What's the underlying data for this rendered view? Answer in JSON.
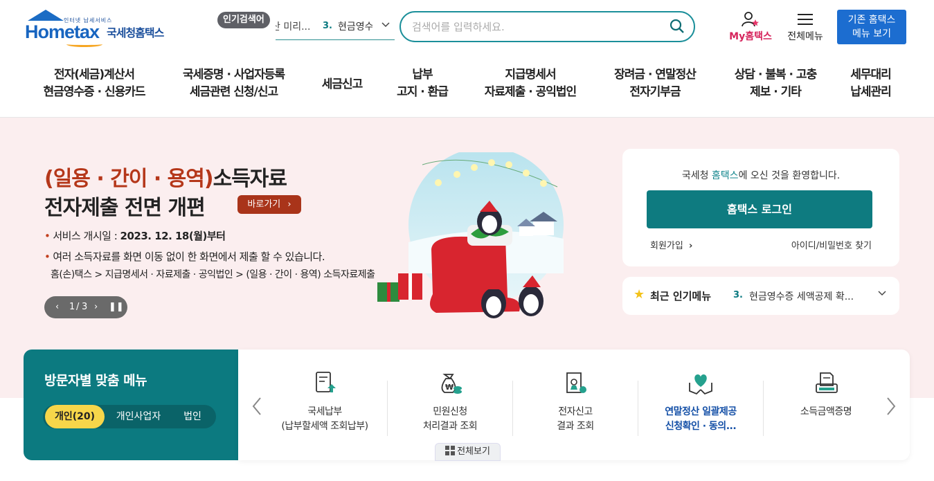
{
  "header": {
    "logo": {
      "tagline": "인터넷 납세서비스",
      "brand": "Hometax",
      "name": "국세청홈택스"
    },
    "popular": {
      "badge": "인기검색어",
      "prev_text": "산 미리...",
      "current_rank": "3.",
      "current_text": "현금영수",
      "chevron": "chevron-down-icon"
    },
    "search": {
      "placeholder": "검색어를 입력하세요.",
      "icon": "search-icon"
    },
    "my_hometax": "My홈택스",
    "all_menu": "전체메뉴",
    "old_hometax": {
      "line1": "기존 홈택스",
      "line2": "메뉴 보기"
    }
  },
  "gnb": [
    {
      "line1": "전자(세금)계산서",
      "line2": "현금영수증 · 신용카드"
    },
    {
      "line1": "국세증명 · 사업자등록",
      "line2": "세금관련 신청/신고"
    },
    {
      "line1": "세금신고",
      "line2": ""
    },
    {
      "line1": "납부",
      "line2": "고지 · 환급"
    },
    {
      "line1": "지급명세서",
      "line2": "자료제출 · 공익법인"
    },
    {
      "line1": "장려금 · 연말정산",
      "line2": "전자기부금"
    },
    {
      "line1": "상담 · 불복 · 고충",
      "line2": "제보 · 기타"
    },
    {
      "line1": "세무대리",
      "line2": "납세관리"
    }
  ],
  "hero": {
    "title_highlight": "(일용 · 간이 · 용역)",
    "title_rest": "소득자료",
    "title_line2": "전자제출 전면 개편",
    "goto_label": "바로가기",
    "start_label": "서비스 개시일 :",
    "start_date": "2023. 12. 18(월)부터",
    "desc": "여러 소득자료를 화면 이동 없이 한 화면에서 제출 할 수 있습니다.",
    "path": "홈(손)택스 > 지급명세서 · 자료제출 · 공익법인 > (일용 · 간이 · 용역) 소득자료제출",
    "pager": {
      "current": "1",
      "total": "3",
      "separator": "/"
    }
  },
  "login": {
    "welcome_prefix": "국세청 ",
    "welcome_brand": "홈택스",
    "welcome_suffix": "에 오신 것을 환영합니다.",
    "login_button": "홈택스 로그인",
    "join": "회원가입",
    "find": "아이디/비밀번호 찾기"
  },
  "recent": {
    "title": "최근 인기메뉴",
    "rank": "3.",
    "value": "현금영수증 세액공제 확...",
    "star_icon": "star-icon"
  },
  "visitor": {
    "title": "방문자별 맞춤 메뉴",
    "tabs": [
      "개인(20)",
      "개인사업자",
      "법인"
    ],
    "active_tab": 0
  },
  "quick_menu": [
    {
      "line1": "국세납부",
      "line2": "(납부할세액 조회납부)",
      "icon": "tax-payment-icon",
      "highlight": false
    },
    {
      "line1": "민원신청",
      "line2": "처리결과 조회",
      "icon": "money-bag-icon",
      "highlight": false
    },
    {
      "line1": "전자신고",
      "line2": "결과 조회",
      "icon": "document-stamp-icon",
      "highlight": false
    },
    {
      "line1": "연말정산 일괄제공",
      "line2": "신청확인 · 동의...",
      "icon": "heart-hands-icon",
      "highlight": true
    },
    {
      "line1": "소득금액증명",
      "line2": "",
      "icon": "printer-document-icon",
      "highlight": false
    }
  ],
  "view_all": "전체보기",
  "colors": {
    "teal": "#0e7b80",
    "brand_blue": "#1c6dd0",
    "hero_bg": "#fbeeef",
    "accent_red": "#a9341a",
    "tab_yellow": "#f7d64a"
  }
}
